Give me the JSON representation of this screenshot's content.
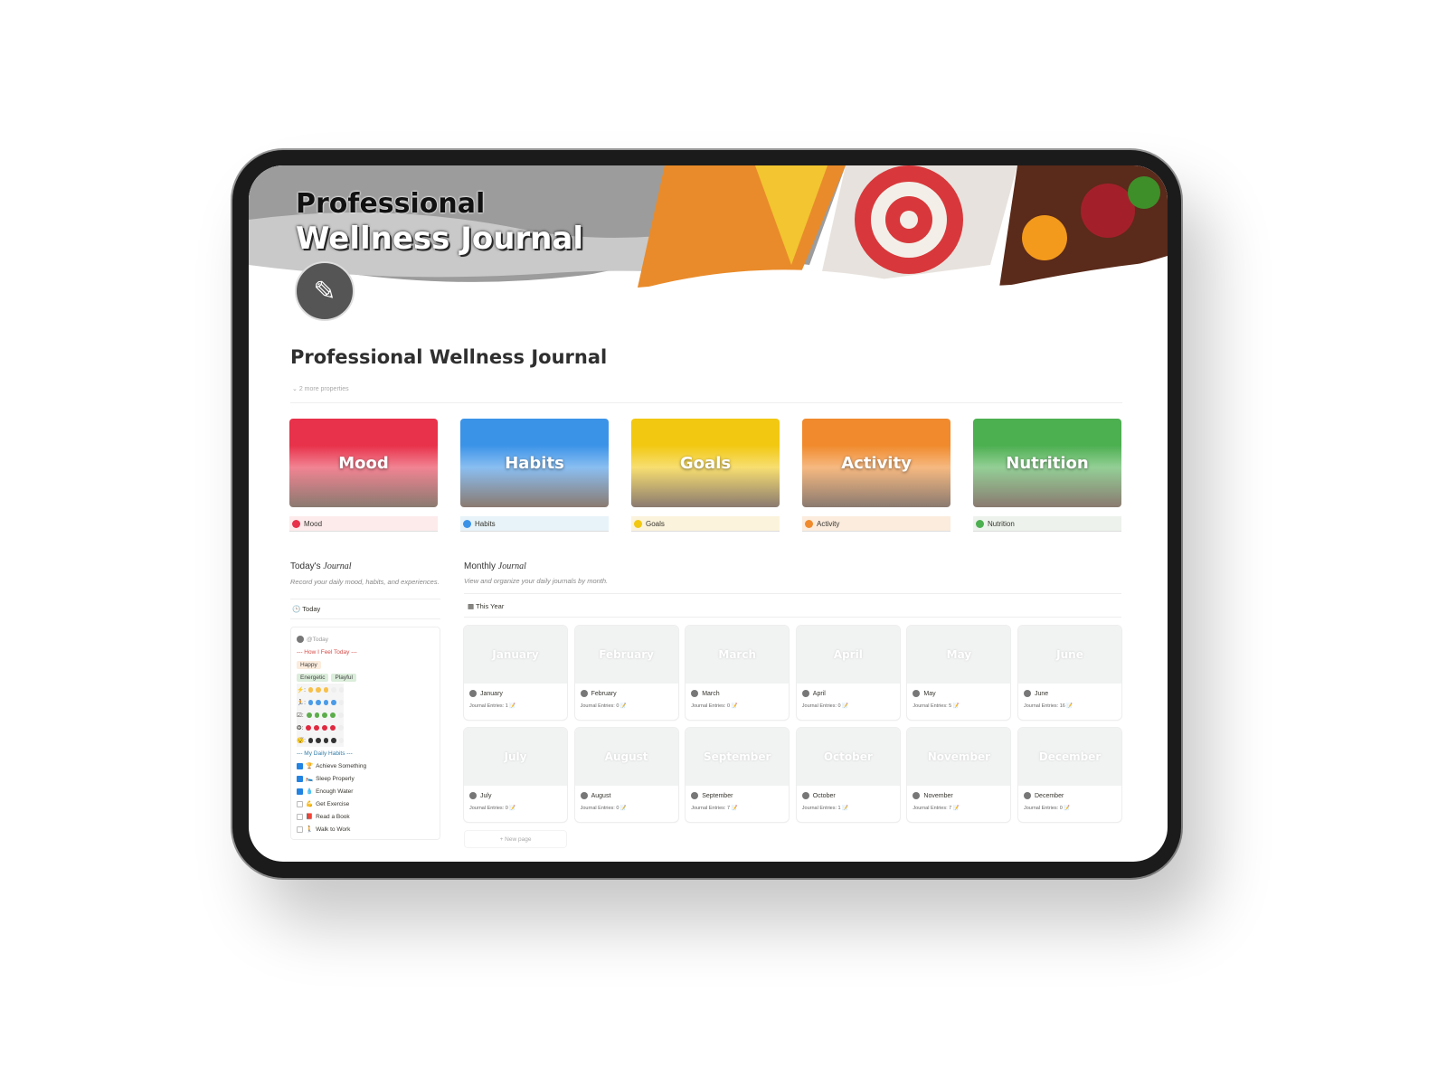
{
  "banner": {
    "line1": "Professional",
    "line2": "Wellness Journal"
  },
  "page": {
    "title": "Professional Wellness Journal",
    "more_properties": "2 more properties"
  },
  "categories": [
    {
      "label": "Mood",
      "color": "#e8314a",
      "bg": "#fdebec"
    },
    {
      "label": "Habits",
      "color": "#3b93e8",
      "bg": "#e7f3f8"
    },
    {
      "label": "Goals",
      "color": "#f2c811",
      "bg": "#fbf3db"
    },
    {
      "label": "Activity",
      "color": "#f08a2c",
      "bg": "#fbecdd"
    },
    {
      "label": "Nutrition",
      "color": "#4caf50",
      "bg": "#edf3ec"
    }
  ],
  "today_journal": {
    "title": "Today's",
    "title_em": "Journal",
    "description": "Record your daily mood, habits, and experiences.",
    "view": "Today",
    "entry": {
      "name": "@Today",
      "feel_header": "--- How I Feel Today ---",
      "mood": "Happy",
      "tags": [
        "Energetic",
        "Playful"
      ],
      "ratings": [
        {
          "icon": "⚡",
          "color": "#f7c04a",
          "value": 3
        },
        {
          "icon": "🏃",
          "color": "#4a9be8",
          "value": 4
        },
        {
          "icon": "☑",
          "color": "#5cad4a",
          "value": 4
        },
        {
          "icon": "❂",
          "color": "#e0283e",
          "value": 4
        },
        {
          "icon": "😴",
          "color": "#333333",
          "value": 4
        }
      ],
      "habits_header": "--- My Daily Habits ---",
      "habits": [
        {
          "icon": "🏆",
          "label": "Achieve Something",
          "done": true
        },
        {
          "icon": "🛌",
          "label": "Sleep Properly",
          "done": true
        },
        {
          "icon": "💧",
          "label": "Enough Water",
          "done": true
        },
        {
          "icon": "💪",
          "label": "Get Exercise",
          "done": false
        },
        {
          "icon": "📕",
          "label": "Read a Book",
          "done": false
        },
        {
          "icon": "🚶",
          "label": "Walk to Work",
          "done": false
        }
      ]
    }
  },
  "monthly_journal": {
    "title": "Monthly",
    "title_em": "Journal",
    "description": "View and organize your daily journals by month.",
    "view": "This Year",
    "new_page": "+ New page",
    "entries_label": "Journal Entries:",
    "months": [
      {
        "name": "January",
        "entries": 1
      },
      {
        "name": "February",
        "entries": 0
      },
      {
        "name": "March",
        "entries": 0
      },
      {
        "name": "April",
        "entries": 0
      },
      {
        "name": "May",
        "entries": 5
      },
      {
        "name": "June",
        "entries": 16
      },
      {
        "name": "July",
        "entries": 0
      },
      {
        "name": "August",
        "entries": 0
      },
      {
        "name": "September",
        "entries": 7
      },
      {
        "name": "October",
        "entries": 1
      },
      {
        "name": "November",
        "entries": 7
      },
      {
        "name": "December",
        "entries": 0
      }
    ]
  }
}
